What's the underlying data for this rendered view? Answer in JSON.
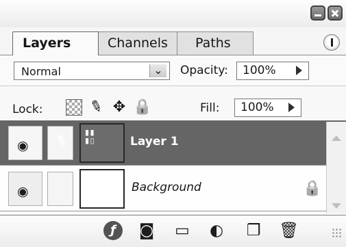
{
  "window": {
    "minimize_icon": "minimize-icon",
    "close_icon": "close-icon"
  },
  "tabs": [
    {
      "label": "Layers",
      "active": true
    },
    {
      "label": "Channels",
      "active": false
    },
    {
      "label": "Paths",
      "active": false
    }
  ],
  "panel_menu_icon": "panel-menu-icon",
  "blend": {
    "mode": "Normal",
    "opacity_label": "Opacity:",
    "opacity_value": "100%"
  },
  "lock": {
    "label": "Lock:",
    "fill_label": "Fill:",
    "fill_value": "100%",
    "icons": [
      "transparent-pixels-icon",
      "image-pixels-icon",
      "move-icon",
      "lock-all-icon"
    ]
  },
  "layers": [
    {
      "name": "Layer 1",
      "selected": true,
      "visible": true
    },
    {
      "name": "Background",
      "selected": false,
      "visible": true,
      "locked": true
    }
  ],
  "toolbar": {
    "icons": [
      "layer-style-icon",
      "mask-icon",
      "folder-icon",
      "adjustment-icon",
      "new-layer-icon",
      "trash-icon"
    ]
  },
  "colors": {
    "selected_row": "#666666",
    "panel_background": "#f1f1f1"
  }
}
